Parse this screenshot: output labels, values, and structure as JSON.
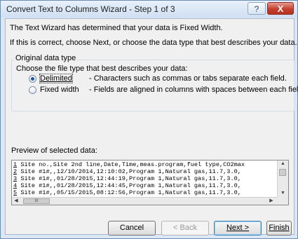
{
  "window": {
    "title": "Convert Text to Columns Wizard - Step 1 of 3",
    "help_glyph": "?",
    "close_glyph": "X"
  },
  "intro": {
    "line1": "The Text Wizard has determined that your data is Fixed Width.",
    "line2": "If this is correct, choose Next, or choose the data type that best describes your data."
  },
  "original_data_type": {
    "title": "Original data type",
    "prompt": "Choose the file type that best describes your data:",
    "options": [
      {
        "label": "Delimited",
        "description": "- Characters such as commas or tabs separate each field.",
        "selected": true
      },
      {
        "label": "Fixed width",
        "description": "- Fields are aligned in columns with spaces between each field.",
        "selected": false
      }
    ]
  },
  "preview": {
    "title": "Preview of selected data:",
    "rows": [
      {
        "num": "1",
        "text": "Site no.,Site 2nd line,Date,Time,meas.program,fuel type,CO2max"
      },
      {
        "num": "2",
        "text": "Site #1#,,12/10/2014,12:10:02,Program 1,Natural gas,11.7,3.0,"
      },
      {
        "num": "3",
        "text": "Site #1#,,01/28/2015,12:44:19,Program 1,Natural gas,11.7,3.0,"
      },
      {
        "num": "4",
        "text": "Site #1#,,01/28/2015,12:44:45,Program 1,Natural gas,11.7,3.0,"
      },
      {
        "num": "5",
        "text": "Site #1#,,05/15/2015,08:12:56,Program 1,Natural gas,11.7,3.0,"
      }
    ],
    "scroll_up": "▲",
    "scroll_down": "▼",
    "scroll_left": "◀",
    "scroll_right": "▶",
    "thumb_grip": "III"
  },
  "buttons": {
    "cancel": "Cancel",
    "back": "< Back",
    "next": "Next >",
    "finish": "Finish"
  }
}
